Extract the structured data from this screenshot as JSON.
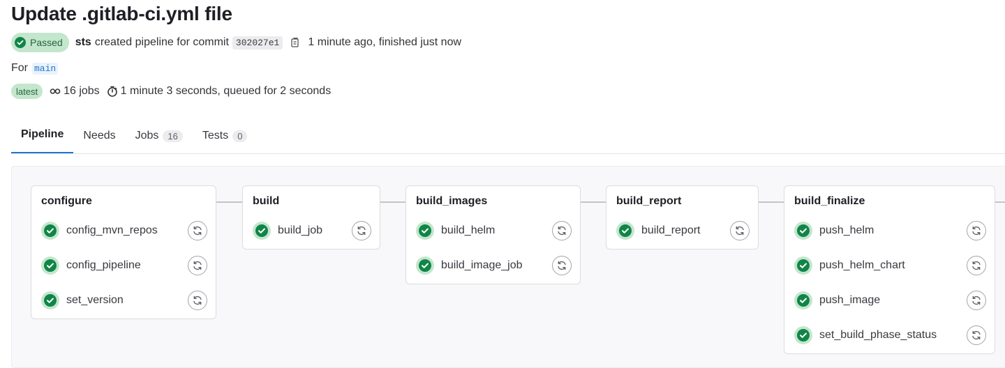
{
  "header": {
    "title": "Update .gitlab-ci.yml file",
    "status": "Passed",
    "author": "sts",
    "created_text": "created pipeline for commit",
    "commit_sha": "302027e1",
    "time_text": "1 minute ago, finished just now",
    "for_label": "For",
    "branch": "main",
    "latest_badge": "latest",
    "jobs_count_text": "16 jobs",
    "duration_text": "1 minute 3 seconds, queued for 2 seconds"
  },
  "tabs": [
    {
      "label": "Pipeline",
      "active": true
    },
    {
      "label": "Needs"
    },
    {
      "label": "Jobs",
      "count": "16"
    },
    {
      "label": "Tests",
      "count": "0"
    }
  ],
  "stages": [
    {
      "name": "configure",
      "jobs": [
        "config_mvn_repos",
        "config_pipeline",
        "set_version"
      ]
    },
    {
      "name": "build",
      "jobs": [
        "build_job"
      ]
    },
    {
      "name": "build_images",
      "jobs": [
        "build_helm",
        "build_image_job"
      ]
    },
    {
      "name": "build_report",
      "jobs": [
        "build_report"
      ]
    },
    {
      "name": "build_finalize",
      "jobs": [
        "push_helm",
        "push_helm_chart",
        "push_image",
        "set_build_phase_status"
      ]
    }
  ],
  "colors": {
    "success": "#108548",
    "success_bg": "#c3e6cd",
    "accent": "#1f75cb"
  },
  "icons": {
    "status": "status-success-icon",
    "copy": "copy-icon",
    "needs": "needs-icon",
    "timer": "timer-icon",
    "retry": "retry-icon"
  }
}
